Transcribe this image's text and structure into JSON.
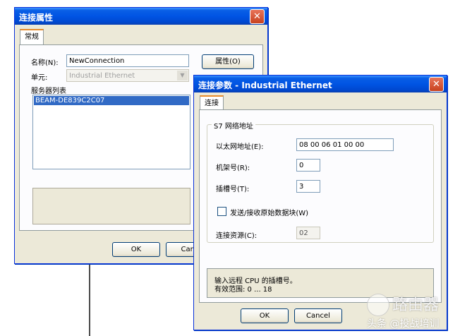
{
  "colors": {
    "title_bar": "#0054e3",
    "dialog_bg": "#ece9d8",
    "selection": "#316ac5",
    "close_button": "#e04a25"
  },
  "back_dialog": {
    "title": "连接属性",
    "tab": "常规",
    "name_label": "名称(N):",
    "name_value": "NewConnection",
    "properties_button": "属性(O)",
    "unit_label": "单元:",
    "unit_value": "Industrial Ethernet",
    "server_list_label": "服务器列表",
    "server_list_items": [
      "BEAM-DE839C2C07"
    ],
    "ok_button": "OK",
    "cancel_button": "Canc"
  },
  "front_dialog": {
    "title": "连接参数 - Industrial Ethernet",
    "tab": "连接",
    "group_title": "S7 网络地址",
    "ethernet_label": "以太网地址(E):",
    "ethernet_value": "08 00 06 01 00 00",
    "rack_label": "机架号(R):",
    "rack_value": "0",
    "slot_label": "插槽号(T):",
    "slot_value": "3",
    "checkbox_label": "发送/接收原始数据块(W)",
    "checkbox_checked": false,
    "resource_label": "连接资源(C):",
    "resource_value": "02",
    "info_line1": "输入远程 CPU 的插槽号。",
    "info_line2": "有效范围: 0 ... 18",
    "ok_button": "OK",
    "cancel_button": "Cancel"
  },
  "watermark": {
    "line1": "路由器",
    "line2": "头条 @投战培训"
  }
}
